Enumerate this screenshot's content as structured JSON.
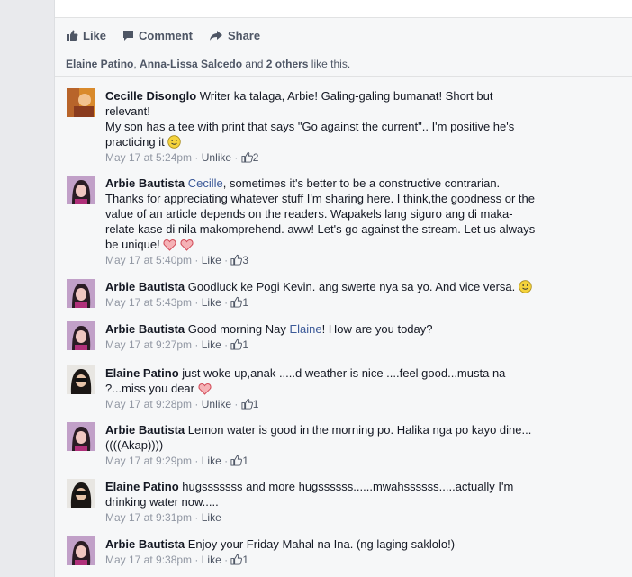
{
  "actions": {
    "like": "Like",
    "comment": "Comment",
    "share": "Share"
  },
  "likes_summary": {
    "name1": "Elaine Patino",
    "sep1": ", ",
    "name2": "Anna-Lissa Salcedo",
    "and": " and ",
    "others": "2 others",
    "tail": " like this."
  },
  "comments": [
    {
      "author": "Cecille Disonglo",
      "text1": "Writer ka talaga, Arbie! Galing-galing bumanat! Short but",
      "text2": "relevant!",
      "text3": "My son has a tee with print that says \"Go against the current\".. I'm positive he's",
      "text4": "practicing it",
      "time": "May 17 at 5:24pm",
      "action": "Unlike",
      "likes": "2"
    },
    {
      "author": "Arbie Bautista",
      "mention": "Cecille",
      "text1": ", sometimes it's better to be a constructive contrarian.",
      "text2": "Thanks for appreciating whatever stuff I'm sharing here. I think,the goodness or the",
      "text3": "value of an article depends on the readers. Wapakels lang siguro ang di maka-",
      "text4": "relate kase di nila makomprehend. aww! Let's go against the stream. Let us always",
      "text5": "be unique!",
      "time": "May 17 at 5:40pm",
      "action": "Like",
      "likes": "3"
    },
    {
      "author": "Arbie Bautista",
      "text1": "Goodluck ke Pogi Kevin. ang swerte nya sa yo. And vice versa.",
      "time": "May 17 at 5:43pm",
      "action": "Like",
      "likes": "1"
    },
    {
      "author": "Arbie Bautista",
      "text1": "Good morning Nay ",
      "mention": "Elaine",
      "text2": "! How are you today?",
      "time": "May 17 at 9:27pm",
      "action": "Like",
      "likes": "1"
    },
    {
      "author": "Elaine Patino",
      "text1": "just woke up,anak .....d weather is nice ....feel good...musta na",
      "text2": "?...miss you dear",
      "time": "May 17 at 9:28pm",
      "action": "Unlike",
      "likes": "1"
    },
    {
      "author": "Arbie Bautista",
      "text1": "Lemon water is good in the morning po. Halika nga po kayo dine...",
      "text2": "((((Akap))))",
      "time": "May 17 at 9:29pm",
      "action": "Like",
      "likes": "1"
    },
    {
      "author": "Elaine Patino",
      "text1": "hugsssssss and more hugssssss......mwahssssss.....actually I'm",
      "text2": "drinking water now.....",
      "time": "May 17 at 9:31pm",
      "action": "Like"
    },
    {
      "author": "Arbie Bautista",
      "text1": "Enjoy your Friday Mahal na Ina. (ng laging saklolo!)",
      "time": "May 17 at 9:38pm",
      "action": "Like",
      "likes": "1"
    }
  ],
  "meta_sep": " · ",
  "colors": {
    "link": "#3b5998",
    "heart": "#e8707a",
    "smiley": "#f5d33c"
  }
}
